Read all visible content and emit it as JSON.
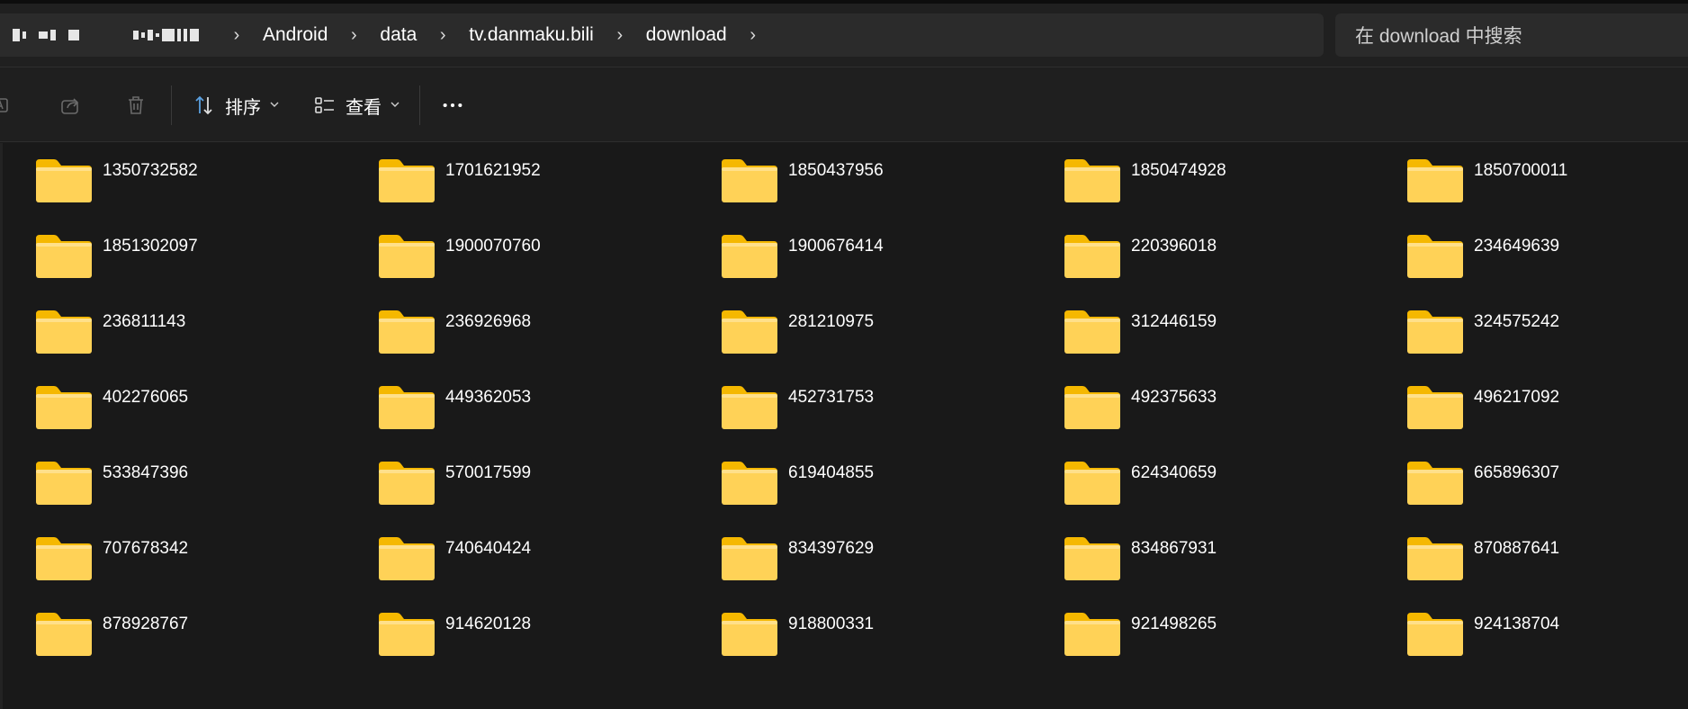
{
  "address_bar": {
    "breadcrumbs": [
      "Android",
      "data",
      "tv.danmaku.bili",
      "download"
    ]
  },
  "search": {
    "placeholder": "在 download 中搜索"
  },
  "command_bar": {
    "sort_label": "排序",
    "view_label": "查看"
  },
  "icons": {
    "folder": "folder-icon",
    "rename": "rename-icon",
    "share": "share-icon",
    "delete": "delete-icon",
    "sort": "sort-icon",
    "view": "view-icon",
    "more": "more-icon",
    "chevron": "chevron-right-icon"
  },
  "colors": {
    "background": "#191919",
    "folder_front": "#ffd257",
    "folder_back": "#f5b800",
    "accent": "#5aa0e0"
  },
  "folders": [
    "1350732582",
    "1701621952",
    "1850437956",
    "1850474928",
    "1850700011",
    "1851302097",
    "1900070760",
    "1900676414",
    "220396018",
    "234649639",
    "236811143",
    "236926968",
    "281210975",
    "312446159",
    "324575242",
    "402276065",
    "449362053",
    "452731753",
    "492375633",
    "496217092",
    "533847396",
    "570017599",
    "619404855",
    "624340659",
    "665896307",
    "707678342",
    "740640424",
    "834397629",
    "834867931",
    "870887641",
    "878928767",
    "914620128",
    "918800331",
    "921498265",
    "924138704"
  ]
}
